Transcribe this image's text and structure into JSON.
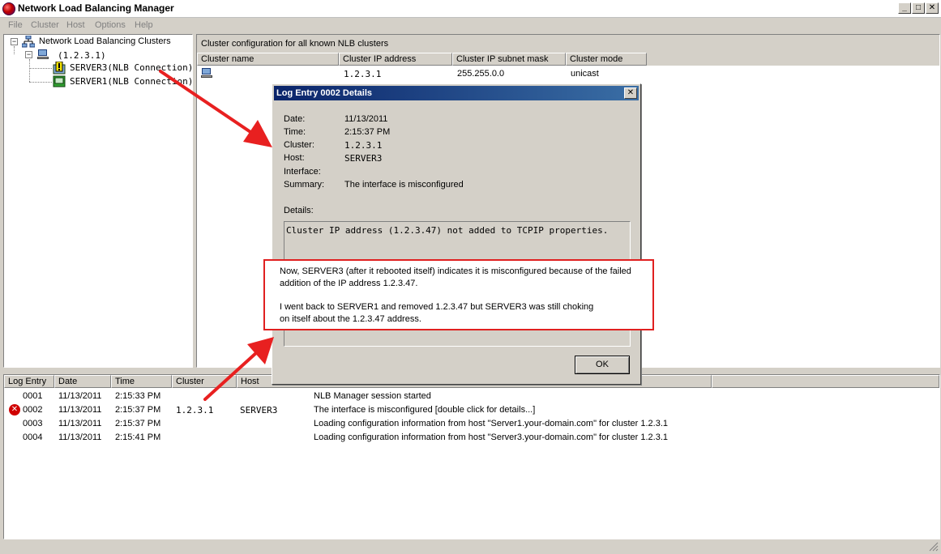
{
  "window": {
    "title": "Network Load Balancing Manager"
  },
  "menu": [
    "File",
    "Cluster",
    "Host",
    "Options",
    "Help"
  ],
  "tree": {
    "root": "Network Load Balancing Clusters",
    "cluster": "(1.2.3.1)",
    "hosts": [
      {
        "label": "SERVER3(NLB Connection)",
        "status": "warning"
      },
      {
        "label": "SERVER1(NLB Connection)",
        "status": "ok"
      }
    ]
  },
  "cluster_pane": {
    "heading": "Cluster configuration for all known NLB clusters",
    "columns": [
      "Cluster name",
      "Cluster IP address",
      "Cluster IP subnet mask",
      "Cluster mode"
    ],
    "rows": [
      {
        "name": "",
        "ip": "1.2.3.1",
        "mask": "255.255.0.0",
        "mode": "unicast"
      }
    ]
  },
  "dialog": {
    "title": "Log Entry 0002 Details",
    "close": "✕",
    "fields": [
      {
        "label": "Date:",
        "value": "11/13/2011"
      },
      {
        "label": "Time:",
        "value": "2:15:37 PM"
      },
      {
        "label": "Cluster:",
        "value": "1.2.3.1"
      },
      {
        "label": "Host:",
        "value": "SERVER3"
      },
      {
        "label": "Interface:",
        "value": ""
      },
      {
        "label": "Summary:",
        "value": "The interface is misconfigured"
      }
    ],
    "details_label": "Details:",
    "details_text": "Cluster IP address (1.2.3.47) not added to TCPIP properties.",
    "ok_label": "OK"
  },
  "annotation": {
    "line1": "Now,  SERVER3  (after it rebooted itself) indicates it is misconfigured because of the failed",
    "line2": "addition of the IP address 1.2.3.47.",
    "line3": "I went back to  SERVER1  and removed   1.2.3.47   but  SERVER3  was still choking",
    "line4": "on itself about the  1.2.3.47  address."
  },
  "log": {
    "columns": [
      "Log Entry",
      "Date",
      "Time",
      "Cluster",
      "Host"
    ],
    "rows": [
      {
        "entry": "0001",
        "date": "11/13/2011",
        "time": "2:15:33 PM",
        "cluster": "",
        "host": "",
        "message": "NLB Manager session started",
        "error": false
      },
      {
        "entry": "0002",
        "date": "11/13/2011",
        "time": "2:15:37 PM",
        "cluster": "1.2.3.1",
        "host": "SERVER3",
        "message": "The interface is misconfigured [double click for details...]",
        "error": true
      },
      {
        "entry": "0003",
        "date": "11/13/2011",
        "time": "2:15:37 PM",
        "cluster": "",
        "host": "",
        "message": "Loading configuration information from host \"Server1.your-domain.com\" for cluster 1.2.3.1",
        "error": false
      },
      {
        "entry": "0004",
        "date": "11/13/2011",
        "time": "2:15:41 PM",
        "cluster": "",
        "host": "",
        "message": "Loading configuration information from host \"Server3.your-domain.com\" for cluster 1.2.3.1",
        "error": false
      }
    ]
  },
  "colors": {
    "arrow": "#e82020",
    "dialog_title": "#0a246a",
    "face": "#d4d0c8"
  }
}
